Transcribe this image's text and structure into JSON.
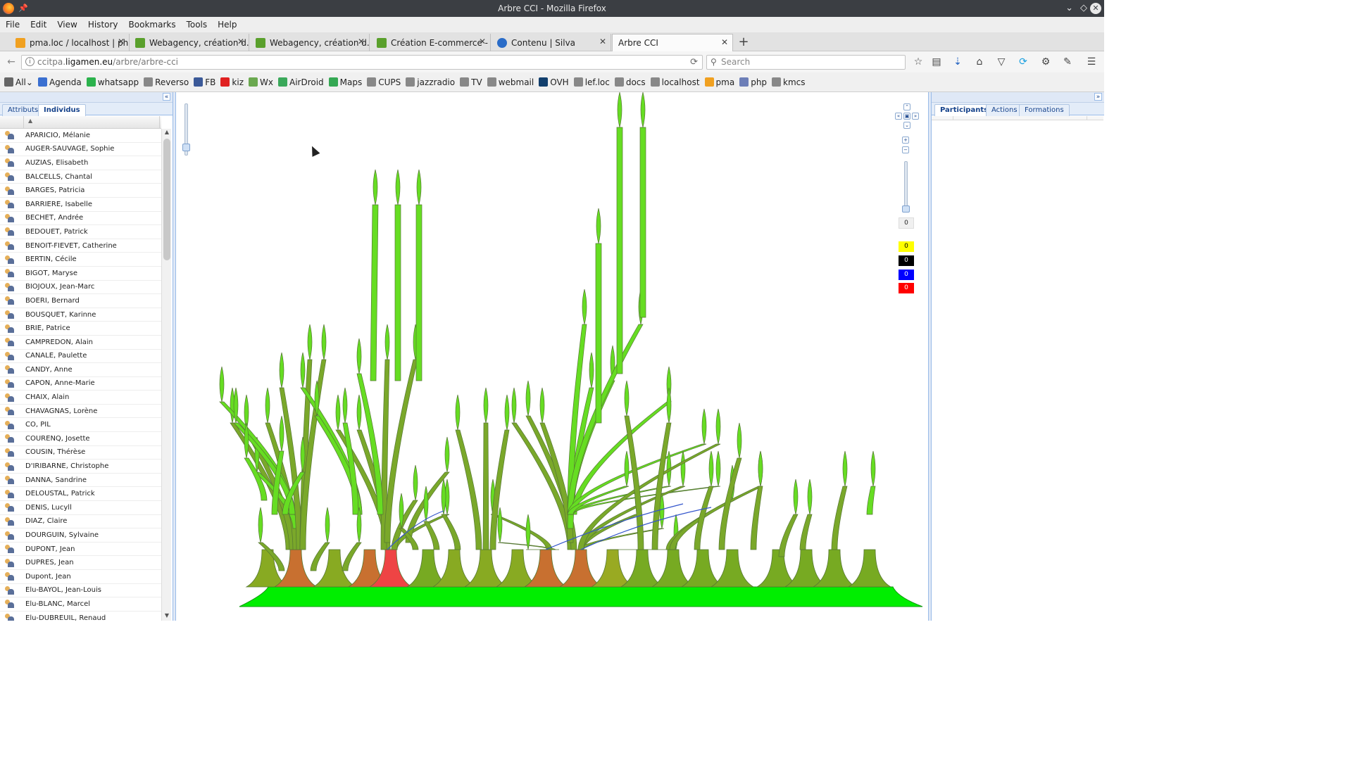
{
  "window": {
    "title": "Arbre CCI - Mozilla Firefox"
  },
  "menu": [
    "File",
    "Edit",
    "View",
    "History",
    "Bookmarks",
    "Tools",
    "Help"
  ],
  "tabs": [
    {
      "label": "pma.loc / localhost | ph...",
      "color": "#f0a020"
    },
    {
      "label": "Webagency, création d...",
      "color": "#5aa02c"
    },
    {
      "label": "Webagency, création d...",
      "color": "#5aa02c"
    },
    {
      "label": "Création E-commerce - ...",
      "color": "#5aa02c"
    },
    {
      "label": "Contenu | Silva",
      "color": "#2a6cc8"
    },
    {
      "label": "Arbre CCI",
      "color": ""
    }
  ],
  "url": {
    "prefix": "ccitpa.",
    "domain": "ligamen.eu",
    "path": "/arbre/arbre-cci"
  },
  "search": {
    "placeholder": "Search"
  },
  "bookmarks": [
    {
      "label": "All",
      "color": "#666"
    },
    {
      "label": "Agenda",
      "color": "#3a6fd0"
    },
    {
      "label": "whatsapp",
      "color": "#2bb24c"
    },
    {
      "label": "Reverso",
      "color": "#888"
    },
    {
      "label": "FB",
      "color": "#3b5998"
    },
    {
      "label": "kiz",
      "color": "#e02020"
    },
    {
      "label": "Wx",
      "color": "#6aa84f"
    },
    {
      "label": "AirDroid",
      "color": "#3aa85a"
    },
    {
      "label": "Maps",
      "color": "#34a853"
    },
    {
      "label": "CUPS",
      "color": "#888"
    },
    {
      "label": "jazzradio",
      "color": "#888"
    },
    {
      "label": "TV",
      "color": "#888"
    },
    {
      "label": "webmail",
      "color": "#888"
    },
    {
      "label": "OVH",
      "color": "#123f6d"
    },
    {
      "label": "lef.loc",
      "color": "#888"
    },
    {
      "label": "docs",
      "color": "#888"
    },
    {
      "label": "localhost",
      "color": "#888"
    },
    {
      "label": "pma",
      "color": "#f0a020"
    },
    {
      "label": "php",
      "color": "#6c7eb7"
    },
    {
      "label": "kmcs",
      "color": "#888"
    }
  ],
  "left_panel": {
    "tabs": [
      "Attributs",
      "Individus"
    ],
    "active_tab": "Individus",
    "individuals": [
      "APARICIO, Mélanie",
      "AUGER-SAUVAGE, Sophie",
      "AUZIAS, Elisabeth",
      "BALCELLS, Chantal",
      "BARGES, Patricia",
      "BARRIERE, Isabelle",
      "BECHET, Andrée",
      "BEDOUET, Patrick",
      "BENOIT-FIEVET, Catherine",
      "BERTIN, Cécile",
      "BIGOT, Maryse",
      "BIOJOUX, Jean-Marc",
      "BOERI, Bernard",
      "BOUSQUET, Karinne",
      "BRIE, Patrice",
      "CAMPREDON, Alain",
      "CANALE, Paulette",
      "CANDY, Anne",
      "CAPON, Anne-Marie",
      "CHAIX, Alain",
      "CHAVAGNAS, Lorène",
      "CO, PIL",
      "COURENQ, Josette",
      "COUSIN, Thérèse",
      "D'IRIBARNE, Christophe",
      "DANNA, Sandrine",
      "DELOUSTAL, Patrick",
      "DENIS, Lucyll",
      "DIAZ, Claire",
      "DOURGUIN, Sylvaine",
      "DUPONT, Jean",
      "DUPRES, Jean",
      "Dupont, Jean",
      "Elu-BAYOL, Jean-Louis",
      "Elu-BLANC, Marcel",
      "Elu-DUBREUIL, Renaud"
    ]
  },
  "controls": {
    "zoom_value": "0",
    "counters": [
      {
        "value": "0",
        "color": "#ffff00",
        "text": "#000"
      },
      {
        "value": "0",
        "color": "#000000",
        "text": "#fff"
      },
      {
        "value": "0",
        "color": "#0000ff",
        "text": "#fff"
      },
      {
        "value": "0",
        "color": "#ff0000",
        "text": "#fff"
      }
    ]
  },
  "right_panel": {
    "tabs": [
      "Participants",
      "Actions",
      "Formations"
    ],
    "active_tab": "Participants"
  },
  "colors": {
    "ground": "#00ee00",
    "leaf": "#66dd22",
    "trunk_dark": "#c87030",
    "trunk_red": "#ee4444",
    "link_blue": "#3355cc"
  }
}
